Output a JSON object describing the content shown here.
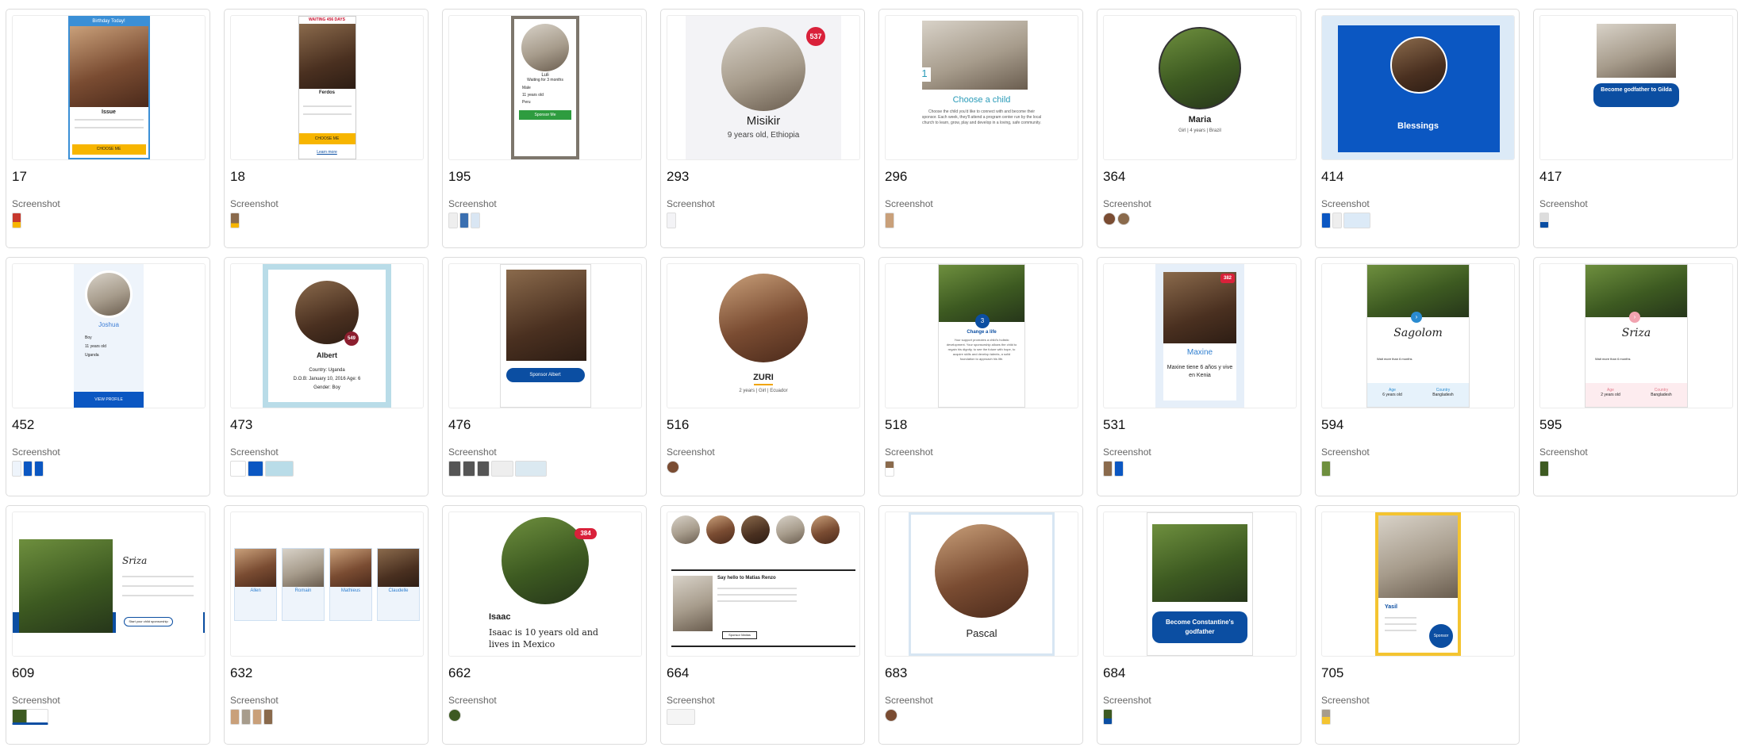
{
  "card_type_label": "Screenshot",
  "cards": [
    {
      "id": "17",
      "title": "Birthday Today!",
      "name": "Issue",
      "button": "CHOOSE ME"
    },
    {
      "id": "18",
      "title": "WAITING 456 DAYS",
      "name": "Ferdos",
      "button": "CHOOSE ME",
      "link": "Learn more"
    },
    {
      "id": "195",
      "name": "Luli",
      "subtitle": "Waiting for 3 months",
      "details": [
        "Male",
        "11 years old",
        "Peru"
      ],
      "button": "Sponsor Me"
    },
    {
      "id": "293",
      "name": "Misikir",
      "subtitle": "9 years old, Ethiopia",
      "badge": "537"
    },
    {
      "id": "296",
      "step": "1",
      "title": "Choose a child",
      "body": "Choose the child you'd like to connect with and become their sponsor. Each week, they'll attend a program center run by the local church to learn, grow, play and develop in a loving, safe community."
    },
    {
      "id": "364",
      "name": "Maria",
      "subtitle": "Girl | 4 years | Brazil"
    },
    {
      "id": "414",
      "name": "Blessings"
    },
    {
      "id": "417",
      "button": "Become godfather to Gilda"
    },
    {
      "id": "452",
      "name": "Joshua",
      "details": [
        "Boy",
        "11 years old",
        "Uganda"
      ],
      "button": "VIEW PROFILE"
    },
    {
      "id": "473",
      "name": "Albert",
      "details": [
        "Country: Uganda",
        "D.O.B: January 10, 2016 Age: 6",
        "Gender: Boy"
      ],
      "badge": "549"
    },
    {
      "id": "476",
      "button": "Sponsor Albert"
    },
    {
      "id": "516",
      "name": "ZURI",
      "subtitle": "2 years | Girl | Ecuador"
    },
    {
      "id": "518",
      "step": "3",
      "title": "Change a life",
      "body": "Your support promotes a child's holistic development. Your sponsorship allows the child to regain his dignity, to see the future with hope, to acquire skills and develop talents, a solid foundation to approach his life."
    },
    {
      "id": "531",
      "name": "Maxine",
      "subtitle": "Maxine tiene 6 años y vive en Kenia",
      "badge": "382"
    },
    {
      "id": "594",
      "name": "Sagolom",
      "subtitle": "Wait more than 6 months",
      "fields": [
        "Age",
        "6 years old",
        "Country",
        "Bangladesh"
      ]
    },
    {
      "id": "595",
      "name": "Sriza",
      "subtitle": "Wait more than 6 months",
      "fields": [
        "Age",
        "2 years old",
        "Country",
        "Bangladesh"
      ]
    },
    {
      "id": "609",
      "name": "Sriza",
      "button": "Start your child sponsorship"
    },
    {
      "id": "632",
      "names": [
        "Allen",
        "Romain",
        "Mathieus",
        "Claudelle"
      ]
    },
    {
      "id": "662",
      "name": "Isaac",
      "subtitle": "Isaac is 10 years old and lives in Mexico",
      "badge": "384"
    },
    {
      "id": "664",
      "title": "Say hello to Matias Renzo",
      "button": "Sponsor Matias"
    },
    {
      "id": "683",
      "name": "Pascal"
    },
    {
      "id": "684",
      "button": "Become Constantine's godfather"
    },
    {
      "id": "705",
      "name": "Yasil",
      "button": "Sponsor"
    }
  ]
}
